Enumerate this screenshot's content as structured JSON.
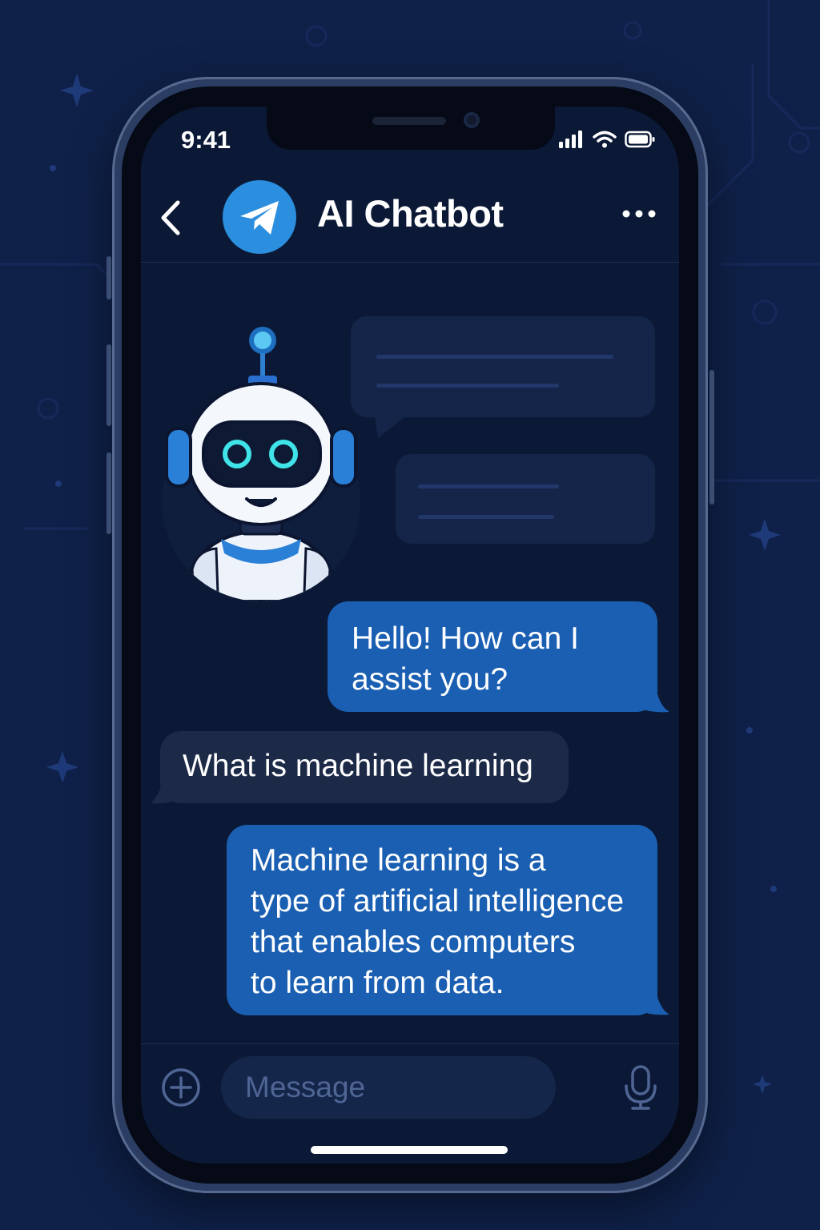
{
  "status_bar": {
    "time": "9:41",
    "icons": [
      "signal-icon",
      "wifi-icon",
      "battery-icon"
    ]
  },
  "header": {
    "title": "AI Chatbot",
    "back_icon": "chevron-left-icon",
    "avatar_icon": "paper-plane-icon",
    "more_icon": "ellipsis-icon"
  },
  "messages": [
    {
      "sender": "bot",
      "text": "Hello! How can I\nassist you?"
    },
    {
      "sender": "user",
      "text": "What is machine learning"
    },
    {
      "sender": "bot",
      "text": "Machine learning is a\ntype of artificial intelligence\nthat enables computers\nto learn from data."
    }
  ],
  "composer": {
    "placeholder": "Message",
    "value": "",
    "attach_icon": "plus-circle-icon",
    "mic_icon": "microphone-icon"
  },
  "colors": {
    "background": "#0f2149",
    "screen": "#0b1936",
    "accent": "#2b8ede",
    "outgoing_bubble": "#1a5fb2",
    "incoming_bubble": "#1c2a48"
  }
}
